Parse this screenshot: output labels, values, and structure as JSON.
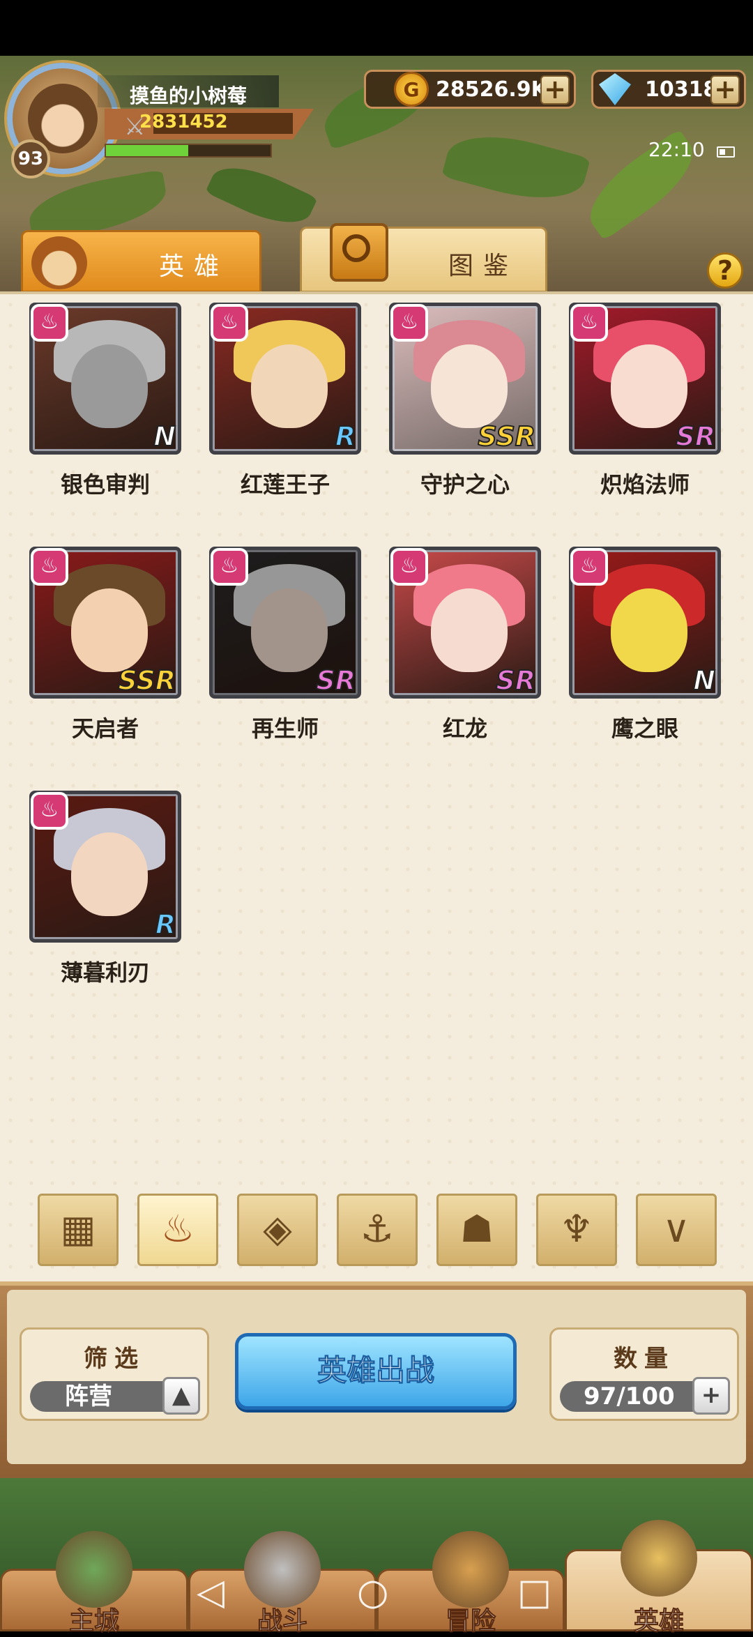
{
  "player": {
    "name": "摸鱼的小树莓",
    "level": "93",
    "power": "2831452",
    "exp_fraction": 0.5
  },
  "currency": {
    "gold": "28526.9K",
    "gold_symbol": "G",
    "gems": "10318",
    "plus": "+"
  },
  "status": {
    "time": "22:10"
  },
  "tabs": [
    {
      "label": "英雄",
      "active": true
    },
    {
      "label": "图鉴",
      "active": false
    }
  ],
  "help": "?",
  "heroes": [
    {
      "name": "银色审判",
      "rarity": "N"
    },
    {
      "name": "红莲王子",
      "rarity": "R"
    },
    {
      "name": "守护之心",
      "rarity": "SSR"
    },
    {
      "name": "炽焰法师",
      "rarity": "SR"
    },
    {
      "name": "天启者",
      "rarity": "SSR"
    },
    {
      "name": "再生师",
      "rarity": "SR"
    },
    {
      "name": "红龙",
      "rarity": "SR"
    },
    {
      "name": "鹰之眼",
      "rarity": "N"
    },
    {
      "name": "薄暮利刃",
      "rarity": "R"
    }
  ],
  "faction_filters": [
    {
      "icon": "grid-icon",
      "glyph": "▦"
    },
    {
      "icon": "flame-icon",
      "glyph": "♨"
    },
    {
      "icon": "diamond-icon",
      "glyph": "◈"
    },
    {
      "icon": "anchor-icon",
      "glyph": "⚓"
    },
    {
      "icon": "beast-icon",
      "glyph": "☗"
    },
    {
      "icon": "demon-icon",
      "glyph": "♆"
    },
    {
      "icon": "wings-icon",
      "glyph": "∨"
    }
  ],
  "filter": {
    "title": "筛选",
    "value": "阵营",
    "toggle": "▲"
  },
  "deploy": {
    "label": "英雄出战"
  },
  "count": {
    "title": "数量",
    "value": "97/100",
    "plus": "+"
  },
  "nav": [
    {
      "label": "主城",
      "icon": "castle-icon"
    },
    {
      "label": "战斗",
      "icon": "crossed-swords-icon"
    },
    {
      "label": "冒险",
      "icon": "adventure-icon"
    },
    {
      "label": "英雄",
      "icon": "hero-helmet-icon"
    }
  ],
  "system_keys": {
    "back": "◁",
    "home": "○",
    "recents": "□"
  }
}
